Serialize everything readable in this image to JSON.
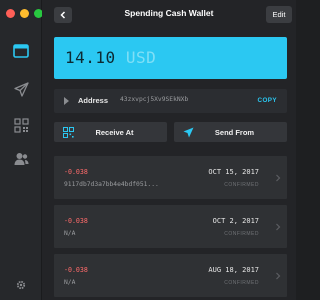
{
  "window": {
    "title": "Spending Cash Wallet",
    "edit_label": "Edit"
  },
  "sidebar": {
    "items": [
      {
        "icon": "wallet-icon"
      },
      {
        "icon": "send-icon"
      },
      {
        "icon": "qr-code-icon"
      },
      {
        "icon": "contacts-icon"
      }
    ],
    "settings_icon": "gear-icon"
  },
  "balance": {
    "amount": "14.10",
    "currency": "USD"
  },
  "address": {
    "label": "Address",
    "value": "43zxvpcj5Xv9SEkNXb",
    "copy_label": "COPY"
  },
  "actions": {
    "receive_label": "Receive At",
    "send_label": "Send From"
  },
  "transactions": [
    {
      "amount": "-0.038",
      "hash": "9117db7d3a7bb4e4bdf051...",
      "date": "OCT 15, 2017",
      "status": "CONFIRMED"
    },
    {
      "amount": "-0.038",
      "hash": "N/A",
      "date": "OCT 2, 2017",
      "status": "CONFIRMED"
    },
    {
      "amount": "-0.038",
      "hash": "N/A",
      "date": "AUG 18, 2017",
      "status": "CONFIRMED"
    }
  ],
  "colors": {
    "accent": "#2bc8f2",
    "negative": "#ff6b6b",
    "background": "#232427",
    "sidebar": "#26282b"
  }
}
